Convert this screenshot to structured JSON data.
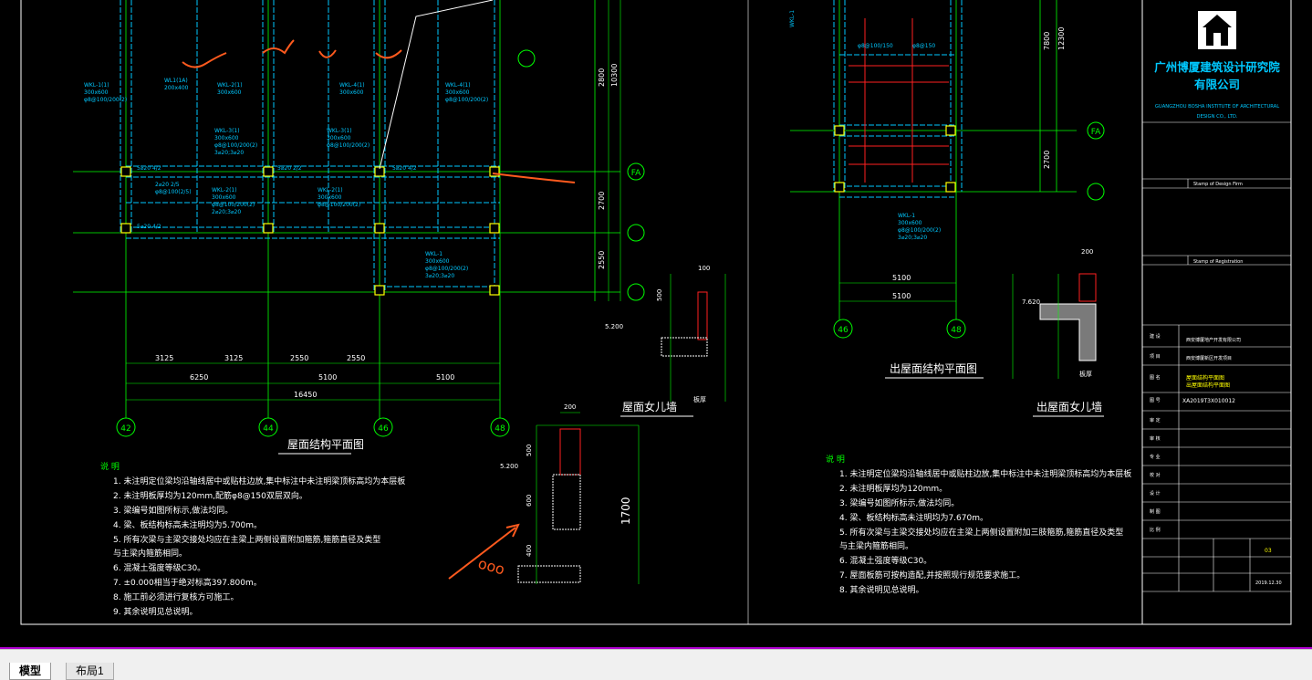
{
  "title_block": {
    "company_cn": "广州博厦建筑设计研究院",
    "company_cn2": "有限公司",
    "company_en": "GUANGZHOU BOSHA INSTITUTE OF ARCHITECTURAL",
    "company_en2": "DESIGN CO., LTD.",
    "stamp_label": "Stamp of Design Firm",
    "reg_label": "Stamp of Registration",
    "project_no": "XA2019T3X010012",
    "date": "2019.12.30"
  },
  "drawings": {
    "roof_plan_title": "屋面结构平面图",
    "roof_parapet_title": "屋面女儿墙",
    "exit_plan_title": "出屋面结构平面图",
    "exit_parapet_title": "出屋面女儿墙",
    "dims_left": [
      "3125",
      "3125",
      "2550",
      "2550",
      "6250",
      "5100",
      "5100",
      "16450"
    ],
    "dims_right": [
      "5100",
      "5100"
    ],
    "axes_bottom_left": [
      "42",
      "44",
      "46",
      "48"
    ],
    "axes_bottom_right": [
      "46",
      "48"
    ],
    "axis_fa": "FA",
    "dims_vertical": [
      "2800",
      "10300",
      "2700",
      "2550",
      "1700",
      "7800",
      "2700",
      "12300"
    ],
    "parapet_dim": "200",
    "parapet_height": "1700",
    "annotation": "ooo"
  },
  "notes_left": {
    "heading": "说 明",
    "items": [
      "1. 未注明定位梁均沿轴线居中或贴柱边放,集中标注中未注明梁顶标高均为本层板",
      "2. 未注明板厚均为120mm,配筋φ8@150双层双向。",
      "3. 梁编号如图所标示,做法均同。",
      "4. 梁、板结构标高未注明均为5.700m。",
      "5. 所有次梁与主梁交接处均应在主梁上两侧设置附加箍筋,箍筋直径及类型",
      "   与主梁内箍筋相同。",
      "6. 混凝土强度等级C30。",
      "7. ±0.000相当于绝对标高397.800m。",
      "8. 施工前必须进行复核方可施工。",
      "9. 其余说明见总说明。"
    ]
  },
  "notes_right": {
    "heading": "说 明",
    "items": [
      "1. 未注明定位梁均沿轴线居中或贴柱边放,集中标注中未注明梁顶标高均为本层板",
      "2. 未注明板厚均为120mm。",
      "3. 梁编号如图所标示,做法均同。",
      "4. 梁、板结构标高未注明均为7.670m。",
      "5. 所有次梁与主梁交接处均应在主梁上两侧设置附加三肢箍筋,箍筋直径及类型",
      "   与主梁内箍筋相同。",
      "6. 混凝土强度等级C30。",
      "7. 屋面板筋可按构造配,并按照现行规范要求施工。",
      "8. 其余说明见总说明。"
    ]
  },
  "tabs": [
    {
      "label": "模型",
      "active": true
    },
    {
      "label": "布局1",
      "active": false
    }
  ],
  "colors": {
    "background": "#000000",
    "cyan": "#00c8ff",
    "green": "#00ff00",
    "yellow": "#ffff00",
    "red": "#ff2020",
    "magenta": "#ff00ff",
    "orange": "#ff5a1e",
    "white": "#ffffff",
    "tab_bar": "#f0f0f0"
  }
}
